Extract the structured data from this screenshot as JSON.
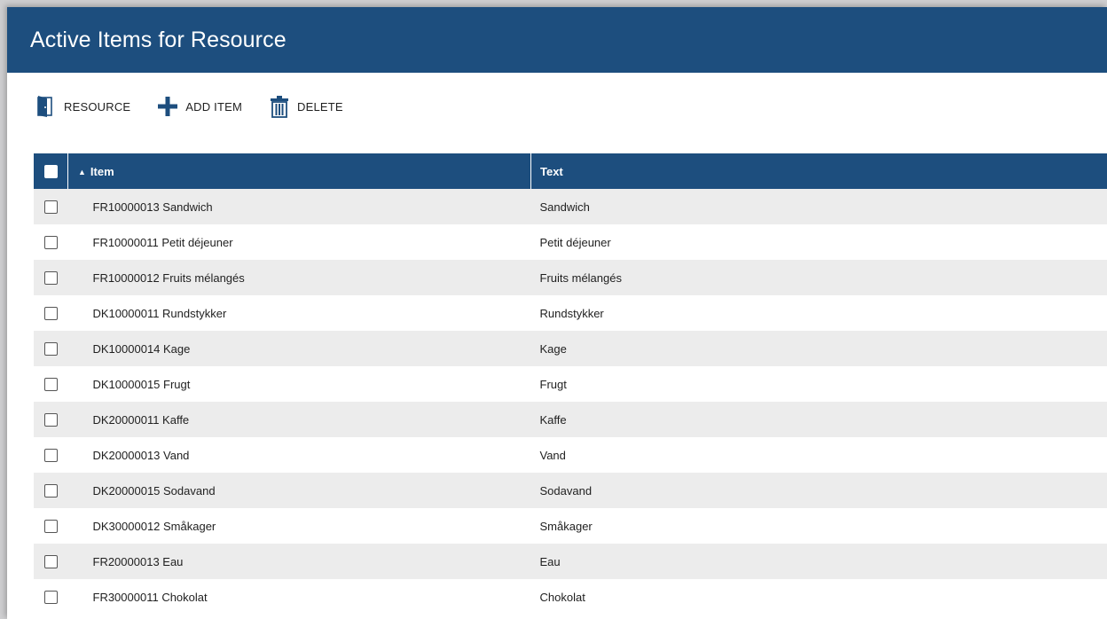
{
  "window": {
    "title": "Active Items for Resource"
  },
  "toolbar": {
    "resource": {
      "label": "RESOURCE",
      "icon": "door-icon"
    },
    "add_item": {
      "label": "ADD ITEM",
      "icon": "plus-icon"
    },
    "delete": {
      "label": "DELETE",
      "icon": "trash-icon"
    }
  },
  "grid": {
    "columns": {
      "item": "Item",
      "text": "Text",
      "item_sort": "ascending"
    },
    "rows": [
      {
        "item": "FR10000013 Sandwich",
        "text": "Sandwich"
      },
      {
        "item": "FR10000011 Petit déjeuner",
        "text": "Petit déjeuner"
      },
      {
        "item": "FR10000012 Fruits mélangés",
        "text": "Fruits mélangés"
      },
      {
        "item": "DK10000011 Rundstykker",
        "text": "Rundstykker"
      },
      {
        "item": "DK10000014 Kage",
        "text": "Kage"
      },
      {
        "item": "DK10000015 Frugt",
        "text": "Frugt"
      },
      {
        "item": "DK20000011 Kaffe",
        "text": "Kaffe"
      },
      {
        "item": "DK20000013 Vand",
        "text": "Vand"
      },
      {
        "item": "DK20000015 Sodavand",
        "text": "Sodavand"
      },
      {
        "item": "DK30000012 Småkager",
        "text": "Småkager"
      },
      {
        "item": "FR20000013 Eau",
        "text": "Eau"
      },
      {
        "item": "FR30000011 Chokolat",
        "text": "Chokolat"
      }
    ]
  },
  "colors": {
    "accent": "#1d4e7e",
    "row_alt": "#ececec"
  }
}
